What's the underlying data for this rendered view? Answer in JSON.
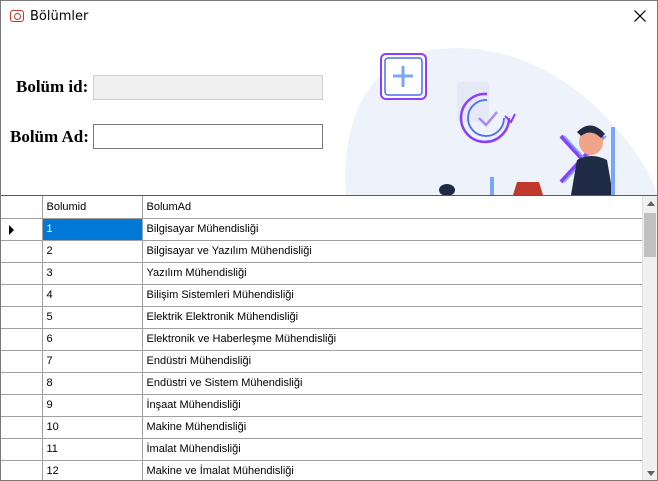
{
  "window": {
    "title": "Bölümler",
    "icon": "app-logo-icon",
    "close_icon": "close-icon"
  },
  "form": {
    "id_label": "Bolüm id:",
    "id_value": "",
    "ad_label": "Bolüm Ad:",
    "ad_value": ""
  },
  "grid": {
    "columns": [
      "Bolumid",
      "BolumAd"
    ],
    "selected_row": 0,
    "rows": [
      {
        "id": "1",
        "ad": "Bilgisayar Mühendisliği"
      },
      {
        "id": "2",
        "ad": "Bilgisayar ve Yazılım Mühendisliği"
      },
      {
        "id": "3",
        "ad": "Yazılım Mühendisliği"
      },
      {
        "id": "4",
        "ad": "Bilişim Sistemleri Mühendisliği"
      },
      {
        "id": "5",
        "ad": "Elektrik Elektronik Mühendisliği"
      },
      {
        "id": "6",
        "ad": "Elektronik ve Haberleşme Mühendisliği"
      },
      {
        "id": "7",
        "ad": "Endüstri Mühendisliği"
      },
      {
        "id": "8",
        "ad": "Endüstri ve Sistem Mühendisliği"
      },
      {
        "id": "9",
        "ad": "İnşaat Mühendisliği"
      },
      {
        "id": "10",
        "ad": "Makine Mühendisliği"
      },
      {
        "id": "11",
        "ad": "İmalat Mühendisliği"
      },
      {
        "id": "12",
        "ad": "Makine ve İmalat Mühendisliği"
      }
    ]
  },
  "colors": {
    "selection": "#0078d7",
    "illustration_bg": "#eef2fa",
    "accent_purple": "#8a3ffc",
    "accent_blue": "#4b6cf7"
  }
}
